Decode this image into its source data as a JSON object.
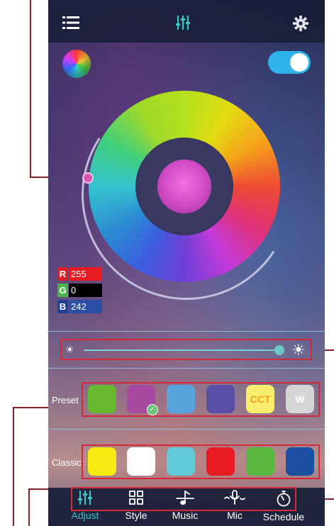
{
  "colors": {
    "accent": "#3bc3c5",
    "callout": "#d32a3a",
    "toggle_on": "#2fb3e9",
    "selected_color": "#d04ac4"
  },
  "topbar": {
    "left_icon": "menu-icon",
    "center_icon": "equalizer-icon",
    "right_icon": "gear-icon"
  },
  "power_toggle": {
    "on": true
  },
  "rgb": {
    "r_label": "R",
    "r_value": "255",
    "g_label": "G",
    "g_value": "0",
    "b_label": "B",
    "b_value": "242"
  },
  "brightness": {
    "level": 0.96
  },
  "preset": {
    "label": "Preset",
    "swatches": [
      {
        "color": "#66b82e",
        "text": "",
        "selected": false
      },
      {
        "color": "#a84aa1",
        "text": "",
        "selected": true
      },
      {
        "color": "#59a4dc",
        "text": "",
        "selected": false
      },
      {
        "color": "#594fa6",
        "text": "",
        "selected": false
      },
      {
        "color": "#f7ec6c",
        "text": "CCT",
        "selected": false
      },
      {
        "color": "#d6d6d6",
        "text": "W",
        "selected": false
      }
    ]
  },
  "classic": {
    "label": "Classic",
    "swatches": [
      {
        "color": "#f6eb12"
      },
      {
        "color": "#ffffff"
      },
      {
        "color": "#62c9d8"
      },
      {
        "color": "#e81b22"
      },
      {
        "color": "#59b63f"
      },
      {
        "color": "#1c4ea1"
      }
    ]
  },
  "tabs": [
    {
      "label": "Adjust",
      "icon": "equalizer-icon",
      "active": true
    },
    {
      "label": "Style",
      "icon": "grid-icon",
      "active": false
    },
    {
      "label": "Music",
      "icon": "music-note-icon",
      "active": false
    },
    {
      "label": "Mic",
      "icon": "microphone-icon",
      "active": false
    },
    {
      "label": "Schedule",
      "icon": "timer-icon",
      "active": false
    }
  ]
}
